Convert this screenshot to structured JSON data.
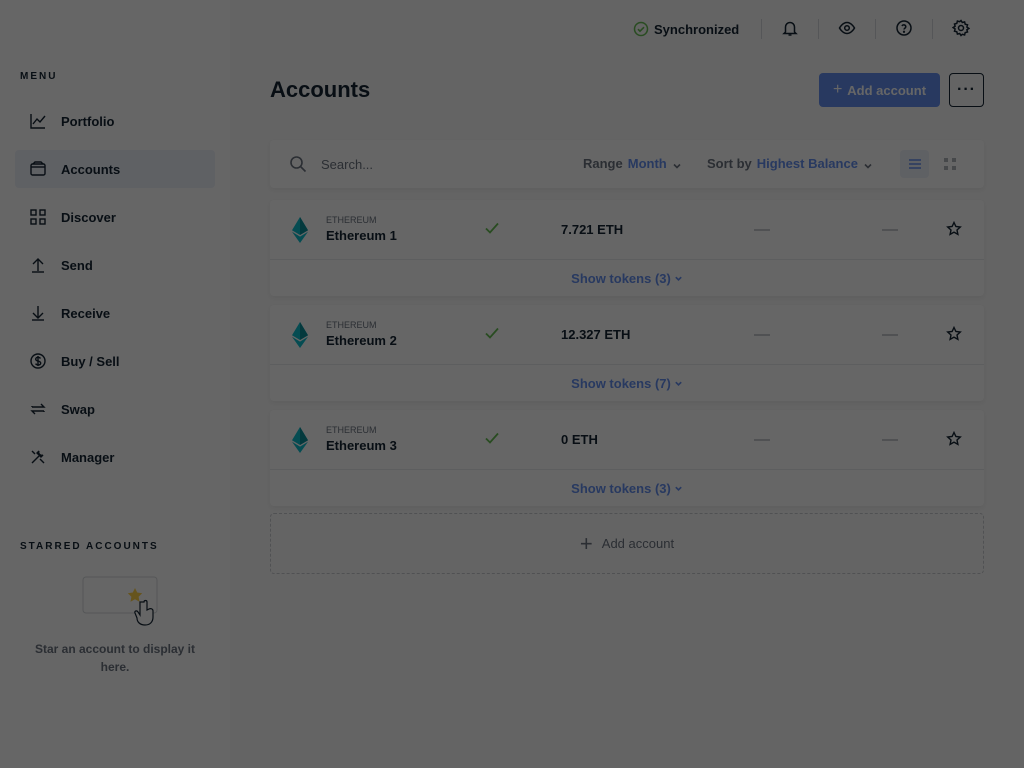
{
  "sidebar": {
    "menu_title": "MENU",
    "items": [
      {
        "label": "Portfolio"
      },
      {
        "label": "Accounts"
      },
      {
        "label": "Discover"
      },
      {
        "label": "Send"
      },
      {
        "label": "Receive"
      },
      {
        "label": "Buy / Sell"
      },
      {
        "label": "Swap"
      },
      {
        "label": "Manager"
      }
    ],
    "active": "Accounts",
    "starred_title": "STARRED ACCOUNTS",
    "starred_empty": "Star an account to display it here."
  },
  "topbar": {
    "sync_status": "Synchronized",
    "icons": [
      "bell-icon",
      "eye-icon",
      "help-icon",
      "gear-icon"
    ]
  },
  "main": {
    "title": "Accounts",
    "add_account": "Add account",
    "more": "···",
    "search_placeholder": "Search...",
    "range_label": "Range",
    "range_value": "Month",
    "sort_label": "Sort by",
    "sort_value": "Highest Balance",
    "accounts": [
      {
        "currency": "ETHEREUM",
        "name": "Ethereum 1",
        "balance": "7.721 ETH",
        "tokens": "Show tokens (3)"
      },
      {
        "currency": "ETHEREUM",
        "name": "Ethereum 2",
        "balance": "12.327 ETH",
        "tokens": "Show tokens (7)"
      },
      {
        "currency": "ETHEREUM",
        "name": "Ethereum 3",
        "balance": "0 ETH",
        "tokens": "Show tokens (3)"
      }
    ],
    "add_account_bottom": "Add account"
  },
  "colors": {
    "accent": "#6490f1",
    "success": "#66be54",
    "star": "#ffd24a"
  }
}
